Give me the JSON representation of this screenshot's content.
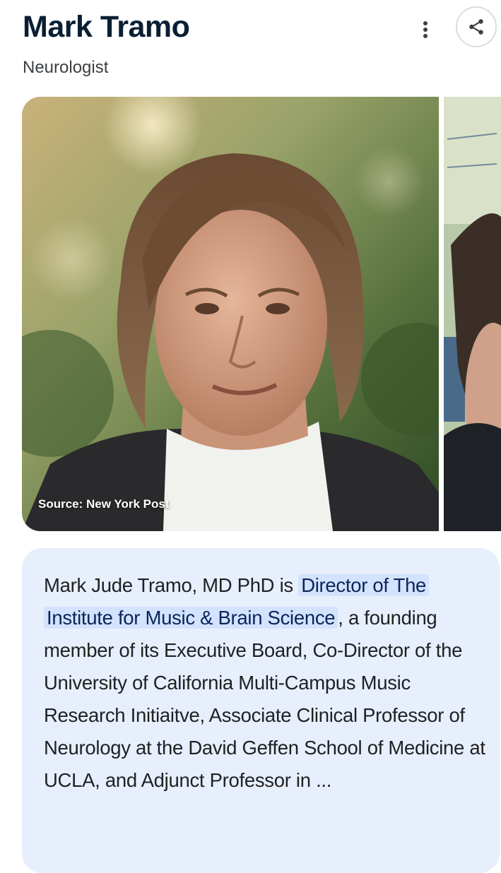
{
  "header": {
    "title": "Mark Tramo",
    "subtitle": "Neurologist"
  },
  "icons": {
    "more": "more-vert-icon",
    "share": "share-icon"
  },
  "images": {
    "main_caption": "Source: New York Post"
  },
  "description": {
    "prefix": "Mark Jude Tramo, MD PhD is ",
    "highlight": "Director of The Institute for Music & Brain Science",
    "suffix": ", a founding member of its Executive Board, Co-Director of the University of California Multi-Campus Music Research Initiaitve, Associate Clinical Professor of Neurology at the David Geffen School of Medicine at UCLA, and Adjunct Professor in ..."
  },
  "colors": {
    "title": "#0b1f33",
    "card_background": "#e8effc",
    "highlight_background": "#d3e3fd"
  }
}
